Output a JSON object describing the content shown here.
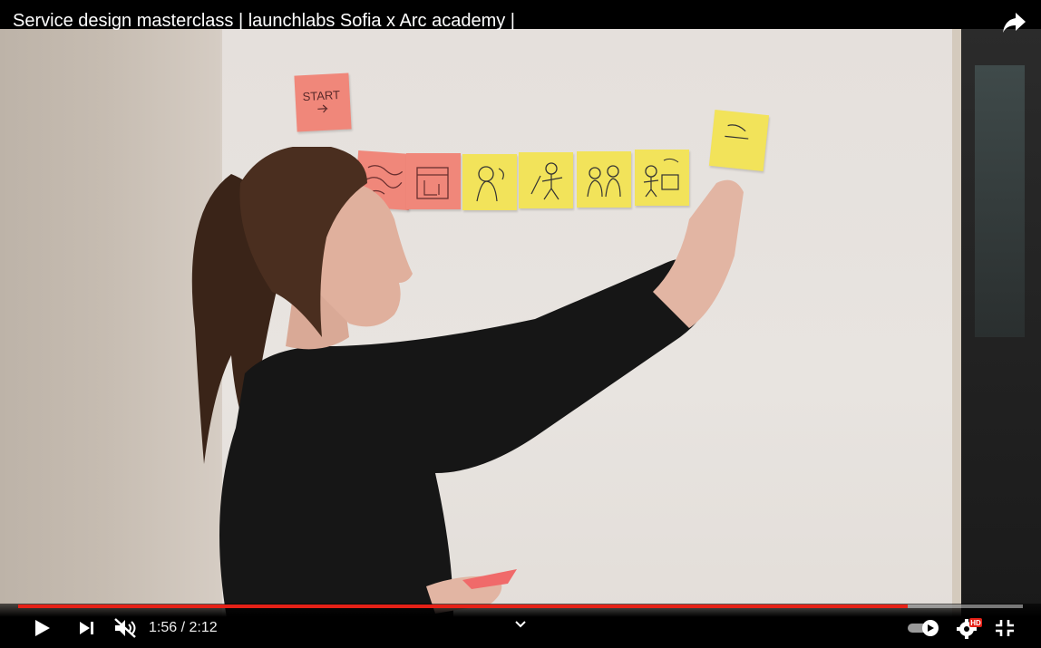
{
  "video": {
    "title": "Service design masterclass | launchlabs Sofia x Arc academy |"
  },
  "playback": {
    "current_time": "1:56",
    "separator": " / ",
    "duration": "2:12",
    "progress": 0.885,
    "muted": true,
    "hd_badge": "HD"
  },
  "icons": {
    "share": "share-icon",
    "play": "play-icon",
    "next": "next-icon",
    "volume": "volume-muted-icon",
    "chevron": "chevron-down-icon",
    "autoplay": "autoplay-toggle-icon",
    "settings": "settings-icon",
    "exit_fullscreen": "exit-fullscreen-icon"
  },
  "colors": {
    "progress": "#e62117",
    "accent": "#ffffff"
  }
}
